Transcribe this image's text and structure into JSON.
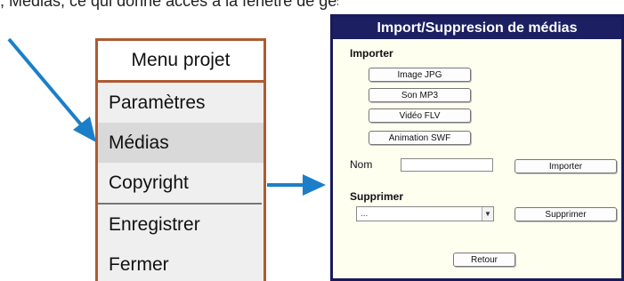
{
  "caption": {
    "text": ", Médias, ce qui donne accès à la fenêtre de gestion des médias du projet"
  },
  "menu": {
    "title": "Menu projet",
    "items": [
      {
        "label": "Paramètres"
      },
      {
        "label": "Médias"
      },
      {
        "label": "Copyright"
      },
      {
        "label": "Enregistrer"
      },
      {
        "label": "Fermer"
      }
    ],
    "selected_item": "Médias"
  },
  "dialog": {
    "title": "Import/Suppresion de médias",
    "import_section": {
      "label": "Importer",
      "buttons": [
        "Image JPG",
        "Son MP3",
        "Vidéo FLV",
        "Animation SWF"
      ],
      "name_label": "Nom",
      "name_value": "",
      "import_button": "Importer"
    },
    "delete_section": {
      "label": "Supprimer",
      "select_value": "...",
      "delete_button": "Supprimer"
    },
    "back_button": "Retour"
  },
  "colors": {
    "arrow": "#1a7fc8",
    "menu_border": "#b05a30",
    "dialog_title_bg": "#1d1f63",
    "dialog_bg": "#fffff0"
  }
}
